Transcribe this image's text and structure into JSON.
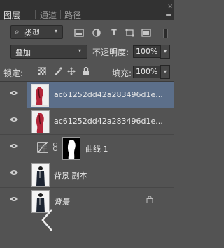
{
  "tabs": [
    {
      "label": "图层",
      "active": true
    },
    {
      "label": "通道",
      "active": false
    },
    {
      "label": "路径",
      "active": false
    }
  ],
  "window": {
    "close_glyph": "×",
    "menu_glyph": "≡"
  },
  "filter": {
    "icon": "search-icon",
    "kind_label": "类型",
    "caret": "▾",
    "icons": [
      "image-filter-icon",
      "adjustment-filter-icon",
      "text-filter-icon",
      "shape-filter-icon",
      "smart-object-filter-icon"
    ]
  },
  "blend": {
    "mode": "叠加",
    "opacity_label": "不透明度:",
    "opacity_value": "100%"
  },
  "lock": {
    "label": "锁定:",
    "fill_label": "填充:",
    "fill_value": "100%",
    "icons": [
      "lock-transparent-icon",
      "lock-paint-icon",
      "lock-move-icon",
      "lock-all-icon"
    ]
  },
  "layers": [
    {
      "name": "ac61252dd42a283496d1e...",
      "selected": true,
      "visible": true
    },
    {
      "name": "ac61252dd42a283496d1e...",
      "selected": false,
      "visible": true
    },
    {
      "name": "曲线 1",
      "selected": false,
      "visible": true,
      "adjustment": "curves"
    },
    {
      "name": "背景 副本",
      "selected": false,
      "visible": true
    },
    {
      "name": "背景",
      "selected": false,
      "visible": true,
      "locked": true
    }
  ],
  "colors": {
    "panel_bg": "#535353",
    "tab_bar": "#323232",
    "selected_row": "#5c6f8a"
  }
}
